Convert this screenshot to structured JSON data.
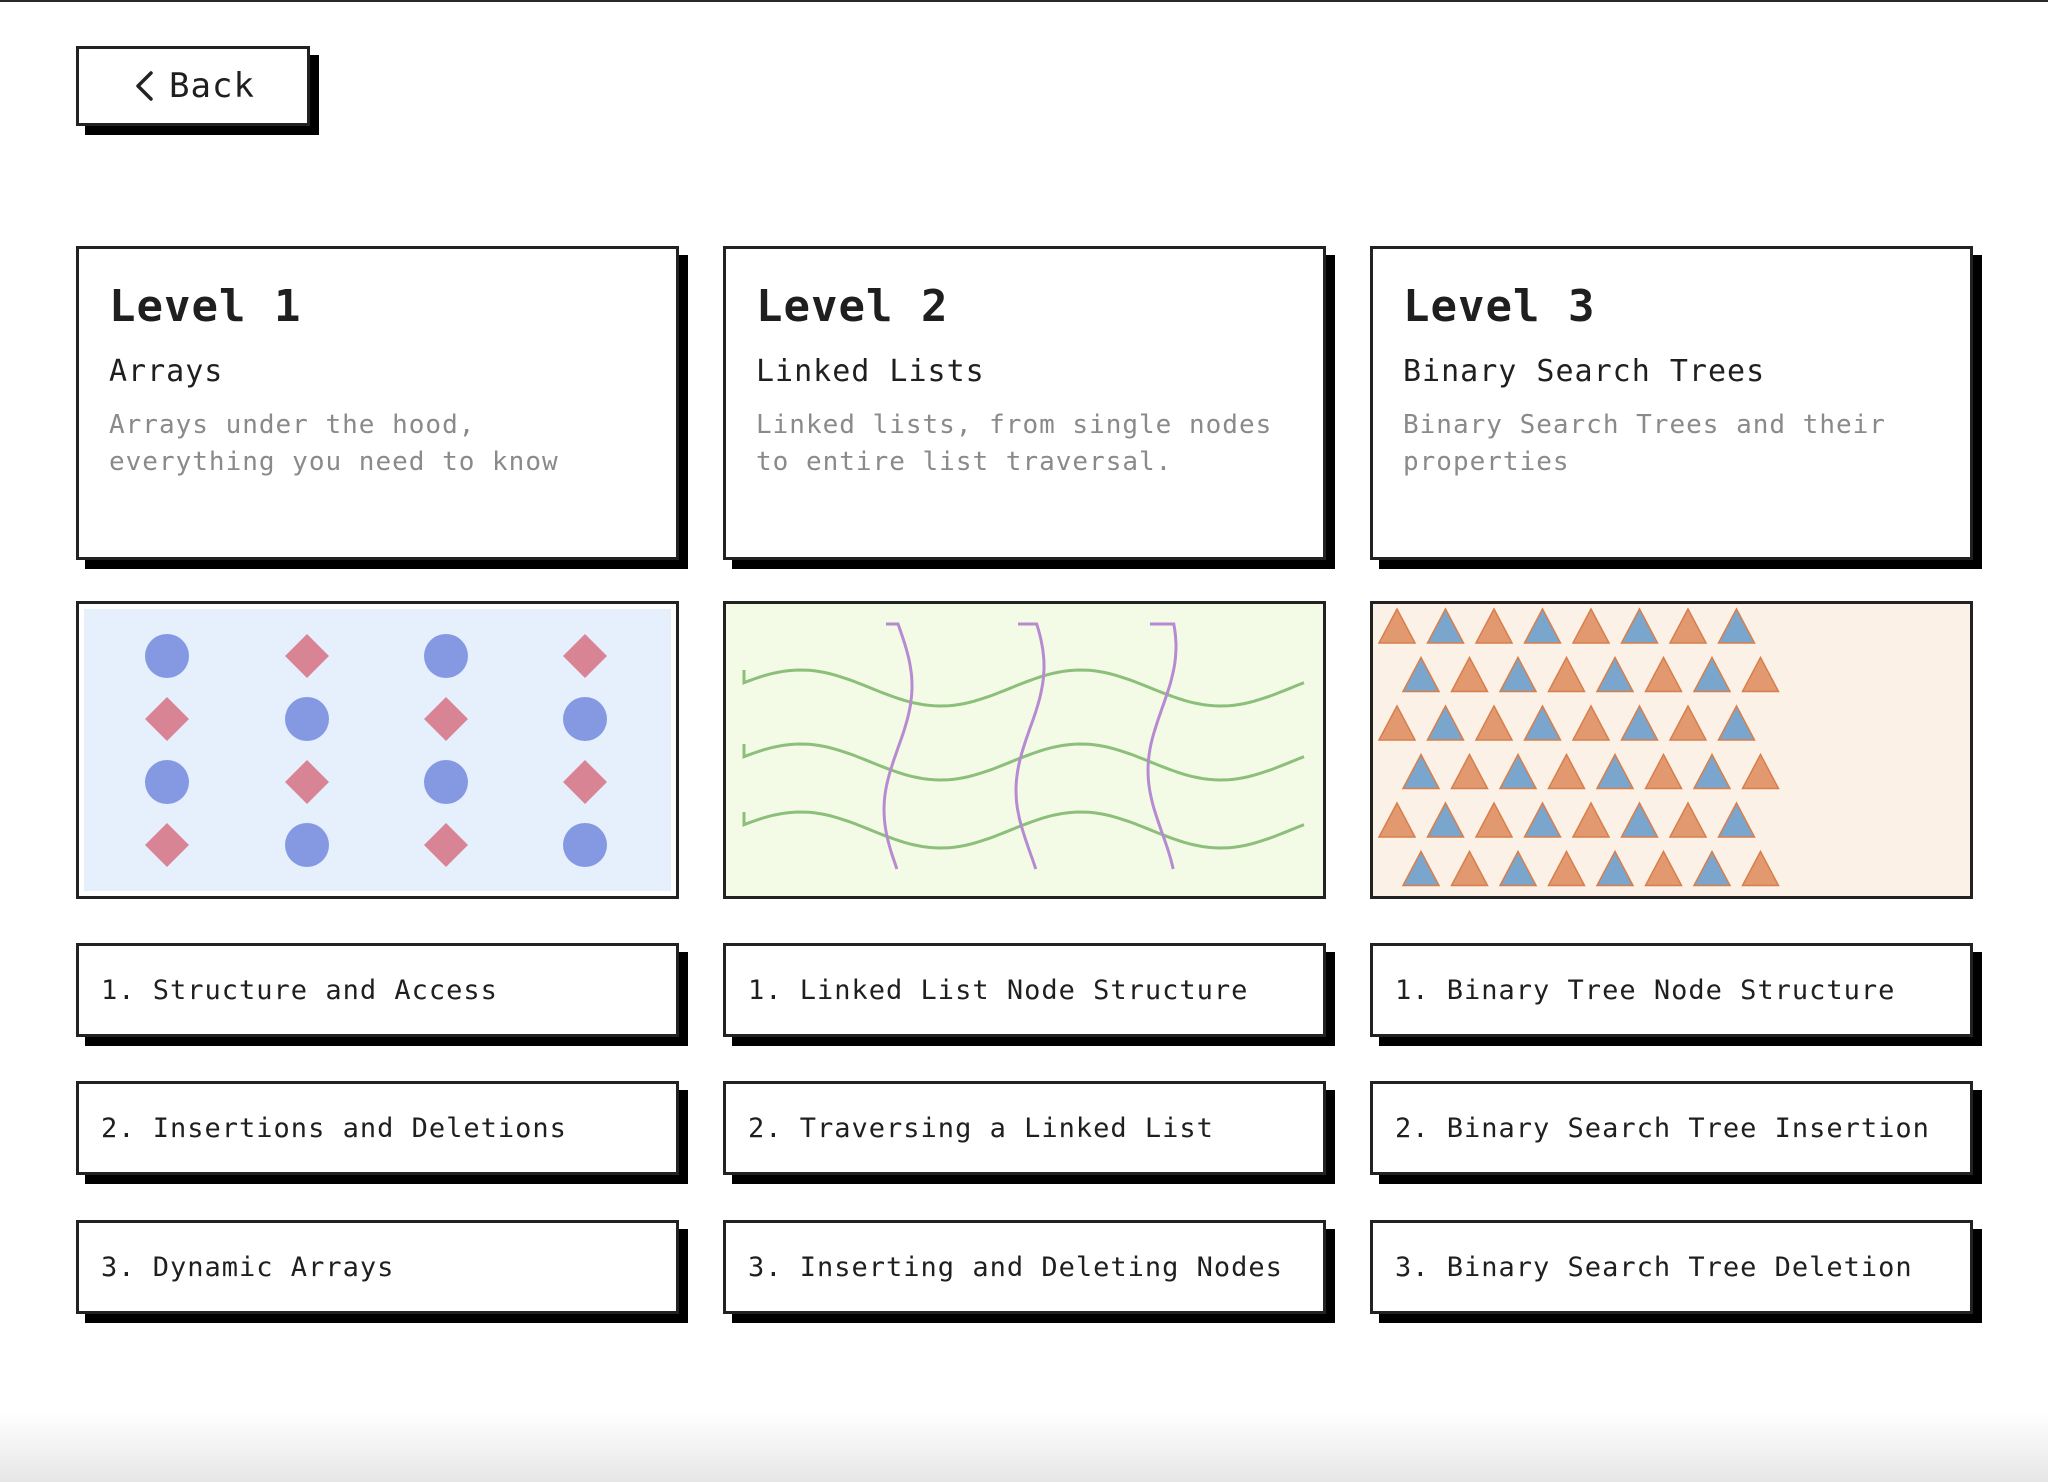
{
  "back": {
    "label": "Back"
  },
  "levels": [
    {
      "title": "Level 1",
      "topic": "Arrays",
      "description": "Arrays under the hood, everything you need to know",
      "lessons": [
        "1. Structure and Access",
        "2. Insertions and Deletions",
        "3. Dynamic Arrays"
      ],
      "art": {
        "kind": "circles-and-diamonds",
        "background": "#e6f0fc",
        "circle_color": "#8599e3",
        "diamond_color": "#d98495"
      }
    },
    {
      "title": "Level 2",
      "topic": "Linked Lists",
      "description": "Linked lists, from single nodes to entire list traversal.",
      "lessons": [
        "1. Linked List Node Structure",
        "2. Traversing a Linked List",
        "3. Inserting and Deleting Nodes"
      ],
      "art": {
        "kind": "woven-waves",
        "background": "#f3fbe6",
        "horizontal_color": "#8cbf7a",
        "vertical_color": "#b68bd1"
      }
    },
    {
      "title": "Level 3",
      "topic": "Binary Search Trees",
      "description": "Binary Search Trees and their properties",
      "lessons": [
        "1. Binary Tree Node Structure",
        "2. Binary Search Tree Insertion",
        "3. Binary Search Tree Deletion"
      ],
      "art": {
        "kind": "triangle-grid",
        "background": "#fcf1e6",
        "orange": "#e2996f",
        "blue": "#7aa6cd"
      }
    }
  ]
}
